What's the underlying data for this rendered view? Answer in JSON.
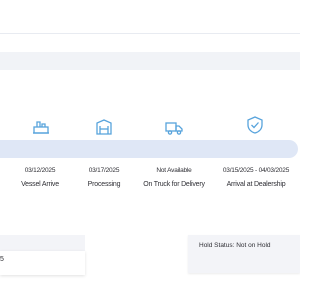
{
  "icon_color": "#57a3dc",
  "steps": [
    {
      "icon": "factory-icon",
      "date": "03/12/2025",
      "label": "Vessel Arrive"
    },
    {
      "icon": "warehouse-icon",
      "date": "03/17/2025",
      "label": "Processing"
    },
    {
      "icon": "truck-icon",
      "date": "Not Available",
      "label": "On Truck for Delivery"
    },
    {
      "icon": "shield-check-icon",
      "date": "03/15/2025 - 04/03/2025",
      "label": "Arrival at Dealership"
    }
  ],
  "left_panel": {
    "value": "5"
  },
  "hold_panel": {
    "status_text": "Hold Status: Not on Hold"
  }
}
